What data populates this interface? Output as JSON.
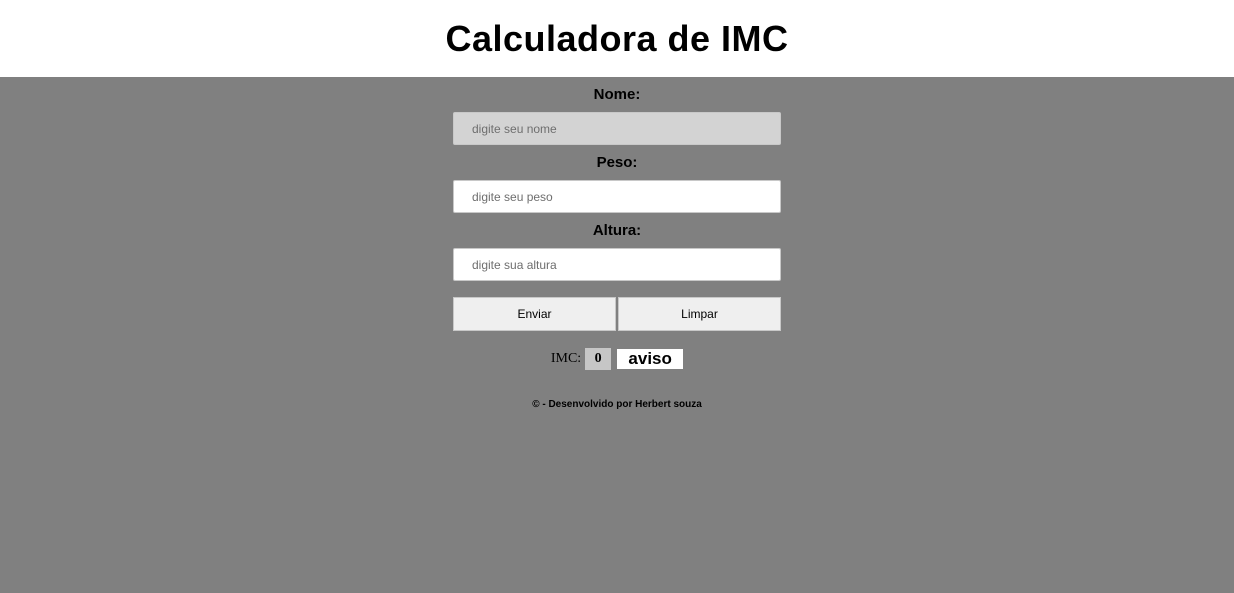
{
  "header": {
    "title": "Calculadora de IMC"
  },
  "form": {
    "nome_label": "Nome:",
    "nome_placeholder": "digite seu nome",
    "nome_value": "",
    "peso_label": "Peso:",
    "peso_placeholder": "digite seu peso",
    "peso_value": "",
    "altura_label": "Altura:",
    "altura_placeholder": "digite sua altura",
    "altura_value": "",
    "enviar_label": "Enviar",
    "limpar_label": "Limpar"
  },
  "result": {
    "imc_label": "IMC:",
    "imc_value": "0",
    "aviso": "aviso"
  },
  "footer": {
    "text": "© - Desenvolvido por Herbert souza"
  },
  "colors": {
    "background": "#808080",
    "header_background": "#ffffff",
    "focused_input": "#d3d3d3",
    "button": "#efefef"
  }
}
